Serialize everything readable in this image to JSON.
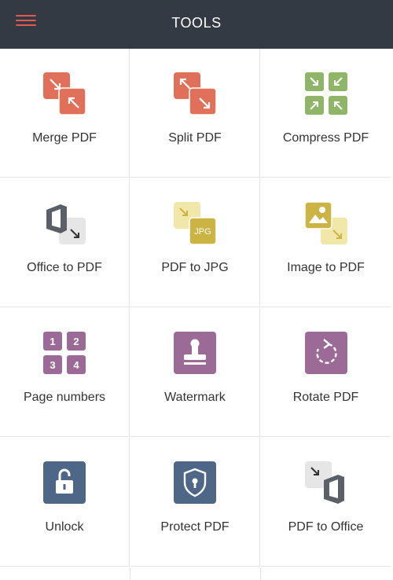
{
  "header": {
    "title": "TOOLS",
    "menu_icon": "hamburger-menu-icon",
    "background": "#343a44",
    "menu_color": "#e05a4f"
  },
  "colors": {
    "merge": "#e0705a",
    "compress": "#8fb568",
    "office": "#5b6068",
    "jpg": "#f1e7a8",
    "jpg_dark": "#cbb443",
    "purple": "#9c6a97",
    "blue": "#4f6787"
  },
  "tools": [
    {
      "label": "Merge PDF",
      "icon": "merge-pdf-icon"
    },
    {
      "label": "Split PDF",
      "icon": "split-pdf-icon"
    },
    {
      "label": "Compress PDF",
      "icon": "compress-pdf-icon"
    },
    {
      "label": "Office to PDF",
      "icon": "office-to-pdf-icon"
    },
    {
      "label": "PDF to JPG",
      "icon": "pdf-to-jpg-icon",
      "badge": "JPG"
    },
    {
      "label": "Image to PDF",
      "icon": "image-to-pdf-icon"
    },
    {
      "label": "Page numbers",
      "icon": "page-numbers-icon",
      "digits": [
        "1",
        "2",
        "3",
        "4"
      ]
    },
    {
      "label": "Watermark",
      "icon": "watermark-stamp-icon"
    },
    {
      "label": "Rotate PDF",
      "icon": "rotate-pdf-icon"
    },
    {
      "label": "Unlock",
      "icon": "unlock-padlock-icon"
    },
    {
      "label": "Protect PDF",
      "icon": "protect-shield-icon"
    },
    {
      "label": "PDF to Office",
      "icon": "pdf-to-office-icon"
    }
  ]
}
